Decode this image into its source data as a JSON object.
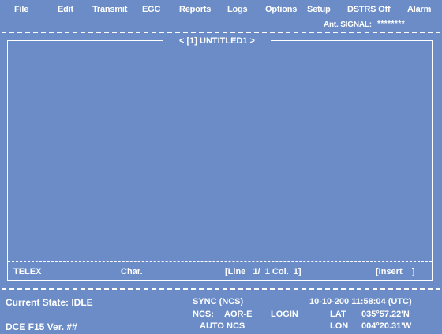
{
  "menu": {
    "file": "File",
    "edit": "Edit",
    "transmit": "Transmit",
    "egc": "EGC",
    "reports": "Reports",
    "logs": "Logs",
    "options": "Options",
    "setup": "Setup",
    "dstrs": "DSTRS Off",
    "alarm": "Alarm"
  },
  "signal": {
    "label": "Ant. SIGNAL:",
    "value": "********"
  },
  "editor": {
    "title": "< [1] UNTITLED1 >"
  },
  "editor_status": {
    "mode": "TELEX",
    "unit": "Char.",
    "position": "[Line   1/  1 Col.  1]",
    "insert": "[Insert    ]"
  },
  "status": {
    "state": "Current State: IDLE",
    "sync": "SYNC (NCS)",
    "datetime": "10-10-200 11:58:04 (UTC)",
    "ncs_label": "NCS:",
    "ncs_value": "AOR-E",
    "login": "LOGIN",
    "lat_label": "LAT",
    "lat_value": "035°57.22'N",
    "version": "DCE F15 Ver. ##",
    "auto_ncs": "AUTO NCS",
    "lon_label": "LON",
    "lon_value": "004°20.31'W"
  }
}
